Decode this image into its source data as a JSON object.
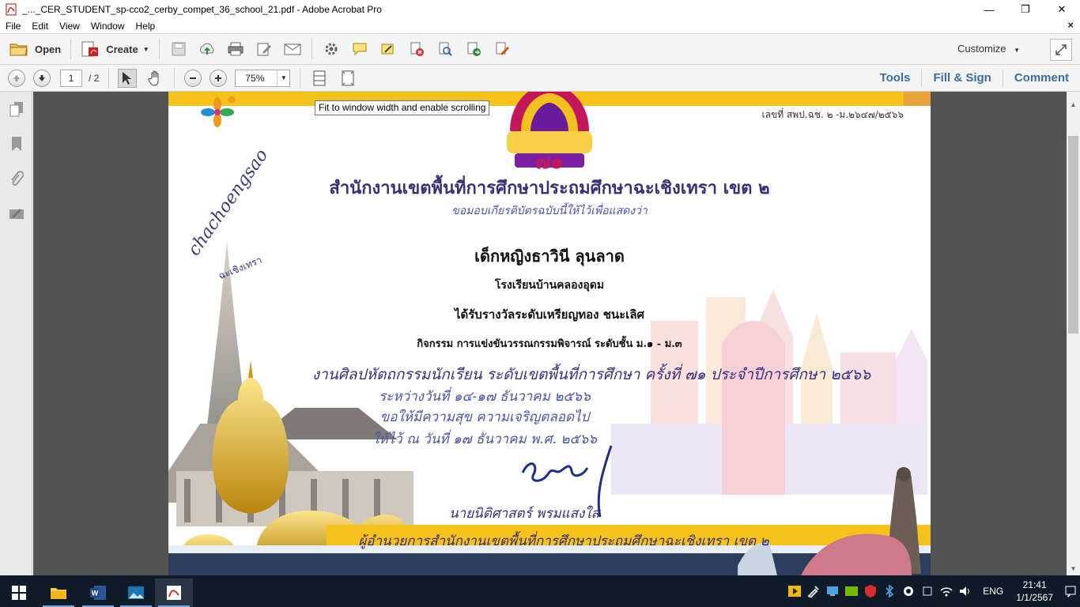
{
  "window": {
    "title": "_..._CER_STUDENT_sp-cco2_cerby_compet_36_school_21.pdf - Adobe Acrobat Pro",
    "controls": {
      "minimize": "—",
      "maximize": "❐",
      "close": "✕"
    }
  },
  "menubar": {
    "items": [
      "File",
      "Edit",
      "View",
      "Window",
      "Help"
    ],
    "close": "×"
  },
  "toolbar": {
    "open_label": "Open",
    "create_label": "Create",
    "customize_label": "Customize"
  },
  "navbar": {
    "page_current": "1",
    "page_total": "/ 2",
    "zoom": "75%",
    "tools_label": "Tools",
    "fill_sign_label": "Fill & Sign",
    "comment_label": "Comment"
  },
  "tooltip": "Fit to window width and enable scrolling",
  "certificate": {
    "doc_number": "เลขที่ สพป.ฉช. ๒ -ม.๒๖๔๗/๒๕๖๖",
    "logo_numeral": "๗๑",
    "office_name": "สำนักงานเขตพื้นที่การศึกษาประถมศึกษาฉะเชิงเทรา เขต ๒",
    "subtitle": "ขอมอบเกียรติบัตรฉบับนี้ให้ไว้เพื่อแสดงว่า",
    "recipient": "เด็กหญิงธาวินี  ลุนลาด",
    "school": "โรงเรียนบ้านคลองอุดม",
    "award": "ได้รับรางวัลระดับเหรียญทอง ชนะเลิศ",
    "activity": "กิจกรรม การแข่งขันวรรณกรรมพิจารณ์ ระดับชั้น ม.๑ - ม.๓",
    "event": "งานศิลปหัตถกรรมนักเรียน ระดับเขตพื้นที่การศึกษา ครั้งที่ ๗๑ ประจำปีการศึกษา ๒๕๖๖",
    "dates": "ระหว่างวันที่ ๑๔-๑๗ ธันวาคม ๒๕๖๖",
    "wish": "ขอให้มีความสุข ความเจริญตลอดไป",
    "given_date": "ให้ไว้ ณ วันที่ ๑๗ ธันวาคม พ.ศ. ๒๕๖๖",
    "signer_name": "นายนิติศาสตร์ พรมแสงใส",
    "signer_position": "ผู้อำนวยการสำนักงานเขตพื้นที่การศึกษาประถมศึกษาฉะเชิงเทรา เขต ๒",
    "script_brand": "chachoengsao",
    "script_brand_thai": "ฉะเชิงเทรา"
  },
  "taskbar": {
    "apps": [
      "start-icon",
      "file-explorer-icon",
      "word-icon",
      "photos-icon",
      "acrobat-icon"
    ],
    "language": "ENG",
    "time": "21:41",
    "date": "1/1/2567"
  },
  "colors": {
    "accent_blue": "#3a6d9e",
    "title_purple": "#3b2f7a",
    "script_blue": "#4a56a8",
    "gold": "#e6b325",
    "taskbar": "#101b2a",
    "viewer_gray": "#535353"
  }
}
